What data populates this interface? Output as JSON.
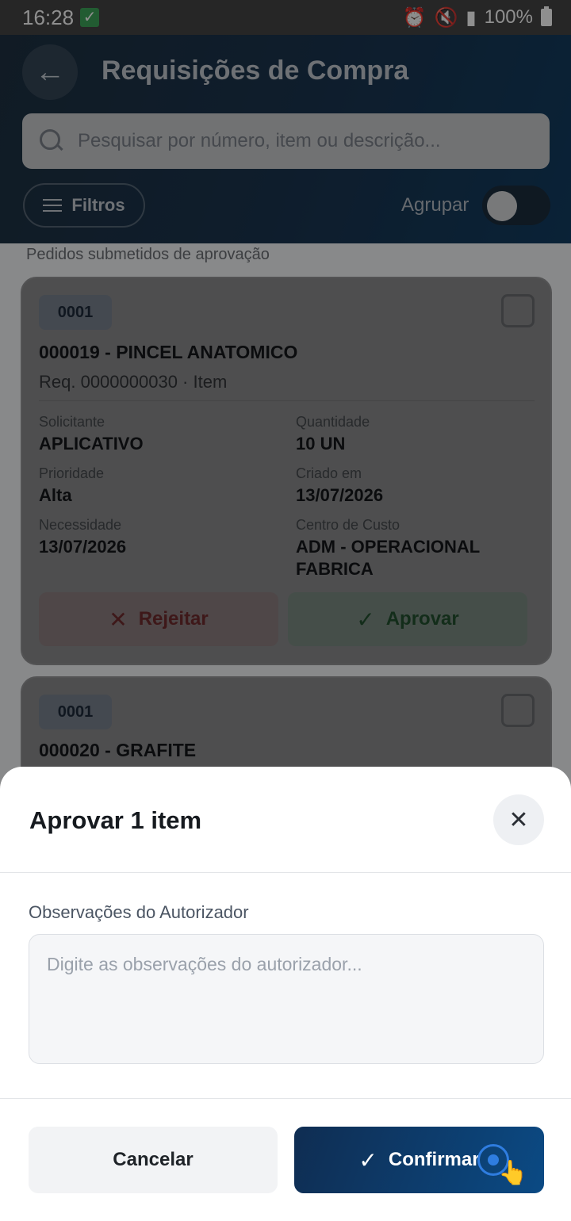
{
  "status_bar": {
    "time": "16:28",
    "battery": "100%"
  },
  "header": {
    "title": "Requisições de Compra",
    "search_placeholder": "Pesquisar por número, item ou descrição...",
    "filters_label": "Filtros",
    "group_label": "Agrupar",
    "group_enabled": false
  },
  "list": {
    "section_label": "Pedidos submetidos de aprovação",
    "cards": [
      {
        "badge": "0001",
        "title": "000019 - PINCEL ANATOMICO",
        "subtitle": "Req. 0000000030 · Item",
        "fields": {
          "solicitante_label": "Solicitante",
          "solicitante": "APLICATIVO",
          "quantidade_label": "Quantidade",
          "quantidade": "10 UN",
          "prioridade_label": "Prioridade",
          "prioridade": "Alta",
          "criado_label": "Criado em",
          "criado": "13/07/2026",
          "necessidade_label": "Necessidade",
          "necessidade": "13/07/2026",
          "centro_label": "Centro de Custo",
          "centro_line1": "ADM - OPERACIONAL",
          "centro_line2": "FABRICA"
        },
        "reject_label": "Rejeitar",
        "approve_label": "Aprovar"
      },
      {
        "badge": "0001",
        "title": "000020 - GRAFITE"
      }
    ]
  },
  "sheet": {
    "title": "Aprovar 1 item",
    "obs_label": "Observações do Autorizador",
    "obs_placeholder": "Digite as observações do autorizador...",
    "cancel_label": "Cancelar",
    "confirm_label": "Confirmar"
  },
  "colors": {
    "header_bg": "#1a3550",
    "confirm_bg": "#0b4a84",
    "reject_text": "#c62828",
    "approve_text": "#2e7d46"
  },
  "icons": [
    "back-arrow-icon",
    "search-icon",
    "filter-icon",
    "check-icon",
    "x-icon",
    "close-icon"
  ]
}
